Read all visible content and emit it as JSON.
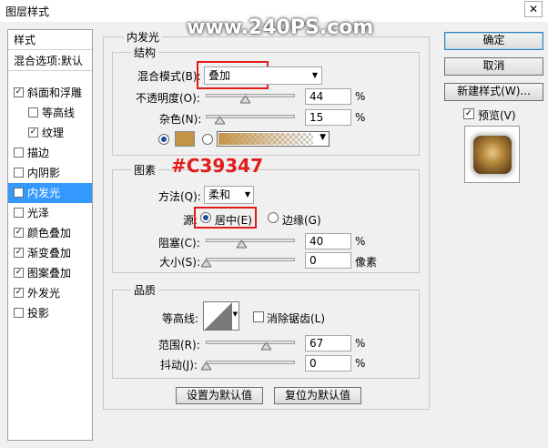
{
  "window": {
    "title": "图层样式",
    "close_glyph": "✕"
  },
  "watermark": "www.240PS.com",
  "annotation": "#C39347",
  "left_panel": {
    "header1": "样式",
    "header2": "混合选项:默认",
    "items": [
      {
        "label": "斜面和浮雕",
        "checked": true,
        "checkmark": "✓"
      },
      {
        "label": "等高线",
        "checked": false,
        "checkmark": ""
      },
      {
        "label": "纹理",
        "checked": true,
        "checkmark": "✓"
      },
      {
        "label": "描边",
        "checked": false,
        "checkmark": ""
      },
      {
        "label": "内阴影",
        "checked": false,
        "checkmark": ""
      },
      {
        "label": "内发光",
        "checked": true,
        "checkmark": "✓"
      },
      {
        "label": "光泽",
        "checked": false,
        "checkmark": ""
      },
      {
        "label": "颜色叠加",
        "checked": true,
        "checkmark": "✓"
      },
      {
        "label": "渐变叠加",
        "checked": true,
        "checkmark": "✓"
      },
      {
        "label": "图案叠加",
        "checked": true,
        "checkmark": "✓"
      },
      {
        "label": "外发光",
        "checked": true,
        "checkmark": "✓"
      },
      {
        "label": "投影",
        "checked": false,
        "checkmark": ""
      }
    ]
  },
  "main": {
    "section_title": "内发光",
    "structure": {
      "title": "结构",
      "blend_mode_label": "混合模式(B):",
      "blend_mode_value": "叠加",
      "opacity_label": "不透明度(O):",
      "opacity_value": "44",
      "noise_label": "杂色(N):",
      "noise_value": "15",
      "percent": "%",
      "color_hex": "#C39347"
    },
    "elements": {
      "title": "图素",
      "method_label": "方法(Q):",
      "method_value": "柔和",
      "source_label": "源:",
      "source_center": "居中(E)",
      "source_edge": "边缘(G)",
      "choke_label": "阻塞(C):",
      "choke_value": "40",
      "size_label": "大小(S):",
      "size_value": "0",
      "size_unit": "像素",
      "percent": "%"
    },
    "quality": {
      "title": "品质",
      "contour_label": "等高线:",
      "antialias_label": "消除锯齿(L)",
      "range_label": "范围(R):",
      "range_value": "67",
      "jitter_label": "抖动(J):",
      "jitter_value": "0",
      "percent": "%"
    },
    "set_default": "设置为默认值",
    "reset_default": "复位为默认值"
  },
  "right": {
    "ok": "确定",
    "cancel": "取消",
    "new_style": "新建样式(W)...",
    "preview_label": "预览(V)"
  },
  "dropdown_arrow": "▼",
  "checkmark": "✓"
}
